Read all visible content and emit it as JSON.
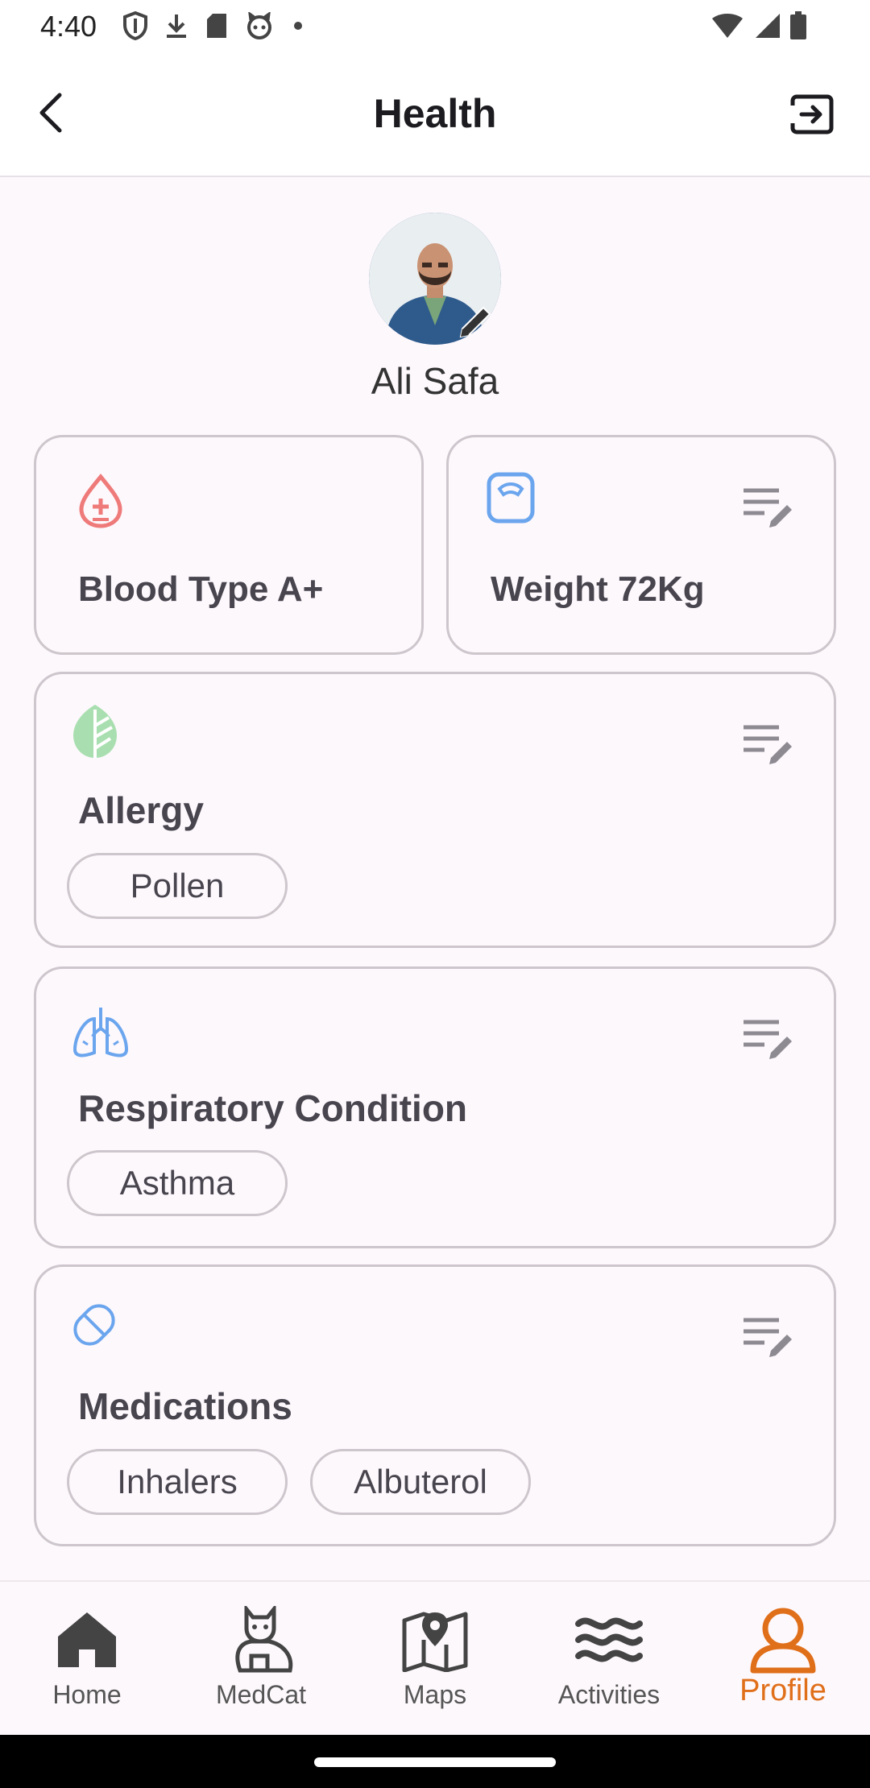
{
  "status": {
    "time": "4:40"
  },
  "appbar": {
    "title": "Health"
  },
  "profile": {
    "name": "Ali Safa"
  },
  "cards": {
    "blood": {
      "title": "Blood Type A+"
    },
    "weight": {
      "title": "Weight 72Kg"
    },
    "allergy": {
      "title": "Allergy",
      "chips": [
        "Pollen"
      ]
    },
    "respiratory": {
      "title": "Respiratory Condition",
      "chips": [
        "Asthma"
      ]
    },
    "medications": {
      "title": "Medications",
      "chips": [
        "Inhalers",
        "Albuterol"
      ]
    }
  },
  "nav": {
    "items": [
      {
        "label": "Home",
        "icon": "home-icon"
      },
      {
        "label": "MedCat",
        "icon": "cat-icon"
      },
      {
        "label": "Maps",
        "icon": "map-icon"
      },
      {
        "label": "Activities",
        "icon": "waves-icon"
      },
      {
        "label": "Profile",
        "icon": "person-icon"
      }
    ],
    "active_index": 4
  },
  "colors": {
    "accent": "#e06f1a",
    "blood_icon": "#ef7a7a",
    "weight_icon": "#6aa5ee",
    "allergy_icon": "#8fd39a",
    "lungs_icon": "#6aa5ee",
    "card_border": "#cdc6cc"
  }
}
